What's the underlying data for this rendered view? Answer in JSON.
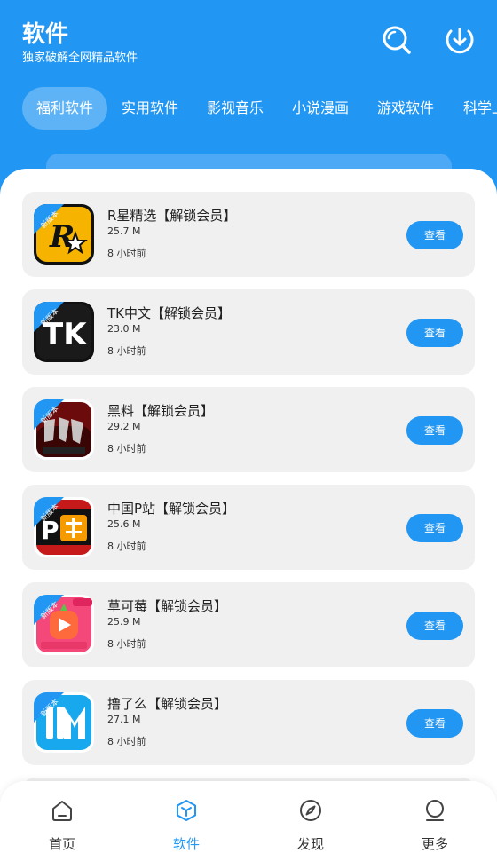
{
  "header": {
    "title": "软件",
    "subtitle": "独家破解全网精品软件",
    "search_icon": "search-icon",
    "download_icon": "download-icon"
  },
  "tabs": [
    {
      "label": "福利软件",
      "active": true
    },
    {
      "label": "实用软件",
      "active": false
    },
    {
      "label": "影视音乐",
      "active": false
    },
    {
      "label": "小说漫画",
      "active": false
    },
    {
      "label": "游戏软件",
      "active": false
    },
    {
      "label": "科学上",
      "active": false
    }
  ],
  "badge_text": "新版本",
  "apps": [
    {
      "name": "R星精选【解锁会员】",
      "size": "25.7 M",
      "time": "8 小时前",
      "button": "查看",
      "icon": "r-star-icon"
    },
    {
      "name": "TK中文【解锁会员】",
      "size": "23.0 M",
      "time": "8 小时前",
      "button": "查看",
      "icon": "tk-icon"
    },
    {
      "name": "黑料【解锁会员】",
      "size": "29.2 M",
      "time": "8 小时前",
      "button": "查看",
      "icon": "heiliao-icon"
    },
    {
      "name": "中国P站【解锁会员】",
      "size": "25.6 M",
      "time": "8 小时前",
      "button": "查看",
      "icon": "p-zhan-icon"
    },
    {
      "name": "草可莓【解锁会员】",
      "size": "25.9 M",
      "time": "8 小时前",
      "button": "查看",
      "icon": "caokemei-icon"
    },
    {
      "name": "撸了么【解锁会员】",
      "size": "27.1 M",
      "time": "8 小时前",
      "button": "查看",
      "icon": "lulema-icon"
    }
  ],
  "bottom_nav": [
    {
      "label": "首页",
      "icon": "home-icon",
      "active": false
    },
    {
      "label": "软件",
      "icon": "cube-icon",
      "active": true
    },
    {
      "label": "发现",
      "icon": "compass-icon",
      "active": false
    },
    {
      "label": "更多",
      "icon": "user-icon",
      "active": false
    }
  ],
  "colors": {
    "primary": "#2196f3",
    "card_bg": "#f0f0f0",
    "text": "#222222"
  }
}
